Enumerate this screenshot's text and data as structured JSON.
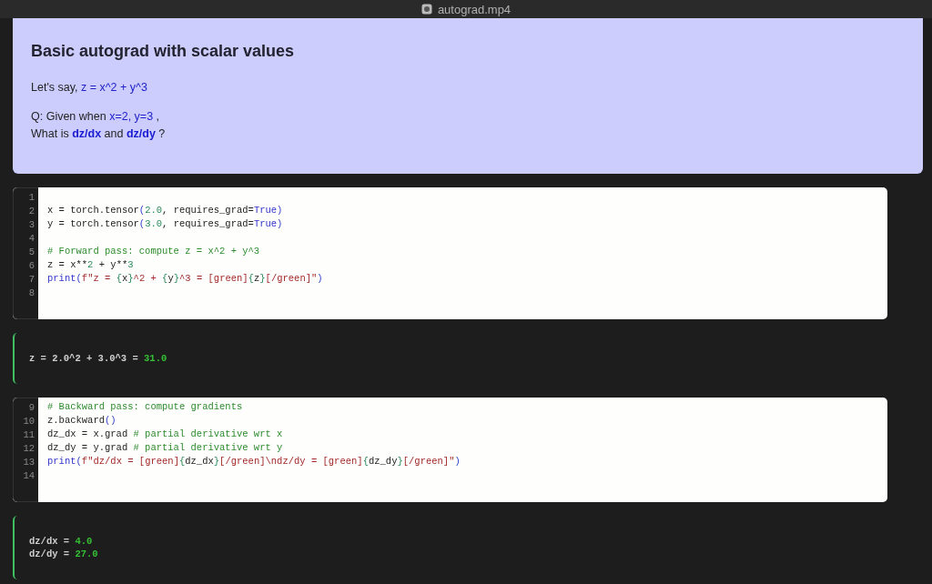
{
  "window": {
    "title": "autograd.mp4"
  },
  "markdown": {
    "heading": "Basic autograd with scalar values",
    "paragraphs": [
      {
        "lines": [
          [
            {
              "kind": "plain",
              "text": "Let's say, "
            },
            {
              "kind": "math",
              "text": "z = x^2 + y^3"
            }
          ]
        ]
      },
      {
        "lines": [
          [
            {
              "kind": "plain",
              "text": "Q: Given when "
            },
            {
              "kind": "math",
              "text": "x=2, y=3"
            },
            {
              "kind": "plain",
              "text": " ,"
            }
          ],
          [
            {
              "kind": "plain",
              "text": "What is "
            },
            {
              "kind": "math_bold",
              "text": "dz/dx"
            },
            {
              "kind": "plain",
              "text": " and "
            },
            {
              "kind": "math_bold",
              "text": "dz/dy"
            },
            {
              "kind": "plain",
              "text": " ?"
            }
          ]
        ]
      }
    ]
  },
  "cells": [
    {
      "kind": "code",
      "lines": [
        {
          "n": "1"
        },
        {
          "n": "2",
          "tokens": [
            {
              "kind": "plain",
              "text": "x = torch.tensor"
            },
            {
              "kind": "paren",
              "text": "("
            },
            {
              "kind": "num",
              "text": "2.0"
            },
            {
              "kind": "plain",
              "text": ", requires_grad="
            },
            {
              "kind": "kw",
              "text": "True"
            },
            {
              "kind": "paren",
              "text": ")"
            }
          ]
        },
        {
          "n": "3",
          "tokens": [
            {
              "kind": "plain",
              "text": "y = torch.tensor"
            },
            {
              "kind": "paren",
              "text": "("
            },
            {
              "kind": "num",
              "text": "3.0"
            },
            {
              "kind": "plain",
              "text": ", requires_grad="
            },
            {
              "kind": "kw",
              "text": "True"
            },
            {
              "kind": "paren",
              "text": ")"
            }
          ]
        },
        {
          "n": "4"
        },
        {
          "n": "5",
          "tokens": [
            {
              "kind": "comment",
              "text": "# Forward pass: compute z = x^2 + y^3"
            }
          ]
        },
        {
          "n": "6",
          "tokens": [
            {
              "kind": "plain",
              "text": "z = x**"
            },
            {
              "kind": "num",
              "text": "2"
            },
            {
              "kind": "plain",
              "text": " + y**"
            },
            {
              "kind": "num",
              "text": "3"
            }
          ]
        },
        {
          "n": "7",
          "tokens": [
            {
              "kind": "kw",
              "text": "print"
            },
            {
              "kind": "paren",
              "text": "("
            },
            {
              "kind": "str",
              "text": "f\"z = "
            },
            {
              "kind": "brace",
              "text": "{"
            },
            {
              "kind": "plain",
              "text": "x"
            },
            {
              "kind": "brace",
              "text": "}"
            },
            {
              "kind": "str",
              "text": "^2 + "
            },
            {
              "kind": "brace",
              "text": "{"
            },
            {
              "kind": "plain",
              "text": "y"
            },
            {
              "kind": "brace",
              "text": "}"
            },
            {
              "kind": "str",
              "text": "^3 = [green]"
            },
            {
              "kind": "brace",
              "text": "{"
            },
            {
              "kind": "plain",
              "text": "z"
            },
            {
              "kind": "brace",
              "text": "}"
            },
            {
              "kind": "str",
              "text": "[/green]\""
            },
            {
              "kind": "paren",
              "text": ")"
            }
          ]
        },
        {
          "n": "8"
        }
      ]
    },
    {
      "kind": "output",
      "lines": [
        [
          {
            "kind": "plain",
            "text": "z = 2.0^2 + 3.0^3 = "
          },
          {
            "kind": "value",
            "text": "31.0"
          }
        ]
      ]
    },
    {
      "kind": "code",
      "lines": [
        {
          "n": "9",
          "tokens": [
            {
              "kind": "comment",
              "text": "# Backward pass: compute gradients"
            }
          ]
        },
        {
          "n": "10",
          "tokens": [
            {
              "kind": "plain",
              "text": "z.backward"
            },
            {
              "kind": "paren",
              "text": "()"
            }
          ]
        },
        {
          "n": "11",
          "tokens": [
            {
              "kind": "plain",
              "text": "dz_dx = x.grad "
            },
            {
              "kind": "comment",
              "text": "# partial derivative wrt x"
            }
          ]
        },
        {
          "n": "12",
          "tokens": [
            {
              "kind": "plain",
              "text": "dz_dy = y.grad "
            },
            {
              "kind": "comment",
              "text": "# partial derivative wrt y"
            }
          ]
        },
        {
          "n": "13",
          "tokens": [
            {
              "kind": "kw",
              "text": "print"
            },
            {
              "kind": "paren",
              "text": "("
            },
            {
              "kind": "str",
              "text": "f\"dz/dx = [green]"
            },
            {
              "kind": "brace",
              "text": "{"
            },
            {
              "kind": "plain",
              "text": "dz_dx"
            },
            {
              "kind": "brace",
              "text": "}"
            },
            {
              "kind": "str",
              "text": "[/green]\\ndz/dy = [green]"
            },
            {
              "kind": "brace",
              "text": "{"
            },
            {
              "kind": "plain",
              "text": "dz_dy"
            },
            {
              "kind": "brace",
              "text": "}"
            },
            {
              "kind": "str",
              "text": "[/green]\""
            },
            {
              "kind": "paren",
              "text": ")"
            }
          ]
        },
        {
          "n": "14"
        }
      ]
    },
    {
      "kind": "output",
      "lines": [
        [
          {
            "kind": "plain",
            "text": "dz/dx = "
          },
          {
            "kind": "value",
            "text": "4.0"
          }
        ],
        [
          {
            "kind": "plain",
            "text": "dz/dy = "
          },
          {
            "kind": "value",
            "text": "27.0"
          }
        ]
      ]
    }
  ]
}
